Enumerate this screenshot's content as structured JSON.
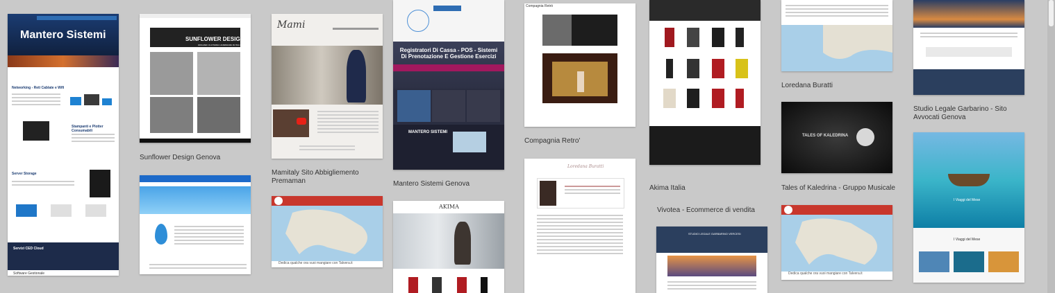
{
  "tiles": {
    "mantero_top": {
      "title": "Mantero Sistemi",
      "section1": "Networking - Reti Cablate e Wifi",
      "section2": "Stampanti e Plotter Consumabili",
      "section3": "Server Storage",
      "section4": "Servizi CED Cloud",
      "footer": "Software Gestionale"
    },
    "sunflower": {
      "banner": "SUNFLOWER DESIGN",
      "sub": "ORGANIC CLOTHING HANDMADE IN ITALY",
      "caption": "Sunflower Design Genova"
    },
    "mamitaly": {
      "logo": "Mami",
      "caption": "Mamitaly Sito Abbigliemento Premaman"
    },
    "mantero_pos": {
      "heading": "Registratori Di Cassa - POS - Sistemi Di Prenotazione E Gestione Esercizi",
      "brand": "MANTERO SISTEMI",
      "caption": "Mantero Sistemi Genova"
    },
    "compagnia": {
      "title": "Compagnia Retrò",
      "caption": "Compagnia Retro'"
    },
    "akima": {
      "caption": "Akima Italia",
      "logo": "AKIMA"
    },
    "vivotea": {
      "caption": "Vivotea - Ecommerce di vendita"
    },
    "loredana": {
      "caption": "Loredana Buratti",
      "signature": "Loredana Buratti"
    },
    "kaledrina": {
      "logo": "TALES OF KALEDRINA",
      "caption": "Tales of Kaledrina - Gruppo Musicale"
    },
    "garbarino": {
      "caption": "Studio Legale Garbarino - Sito Avvocati Genova",
      "header": "STUDIO LEGALE GARBARINO VERCESI"
    },
    "viaggi": {
      "title": "I Viaggi del Mese",
      "subtitle": "I Viaggi del Mese"
    },
    "map1": {
      "bottom": "Dedica qualche ora vuoi mangiare con Talvera.it"
    },
    "map2": {
      "bottom": "Dedica qualche ora vuoi mangiare con Talvera.it"
    }
  },
  "colors": {
    "navy": "#1d2b4a",
    "red": "#c8372d",
    "blue": "#2e6db3"
  }
}
